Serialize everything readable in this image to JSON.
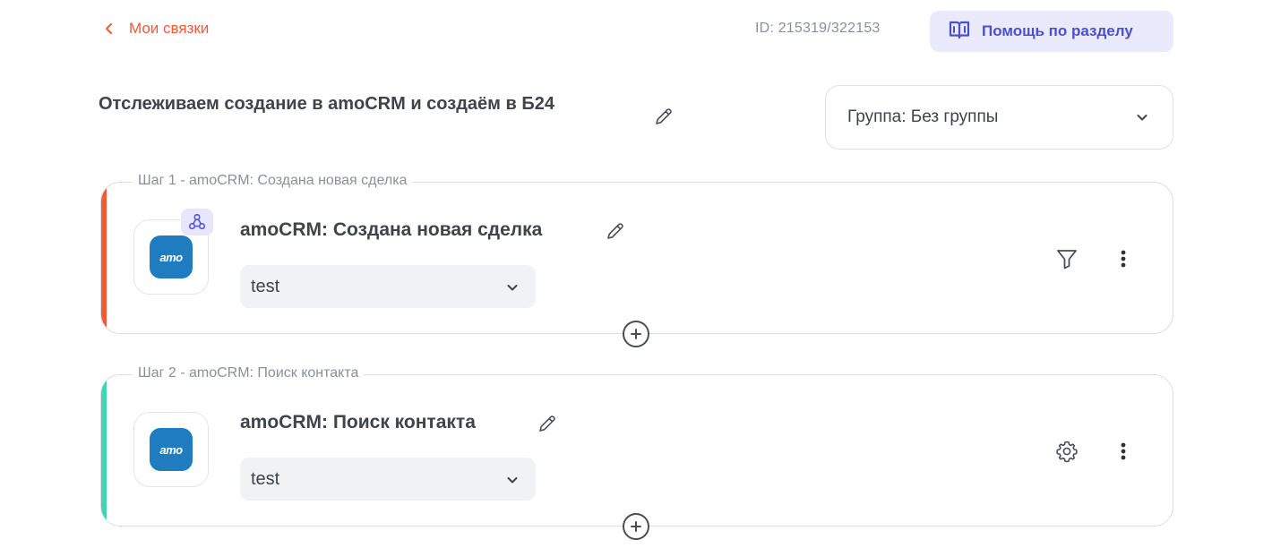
{
  "header": {
    "back_label": "Мои связки",
    "id_text": "ID: 215319/322153",
    "help_label": "Помощь по разделу"
  },
  "title": {
    "text": "Отслеживаем создание в amoCRM и создаём в Б24"
  },
  "group": {
    "label": "Группа: Без группы"
  },
  "steps": [
    {
      "legend": "Шаг 1 - amoCRM: Создана новая сделка",
      "title": "amoCRM: Создана новая сделка",
      "logo_text": "amo",
      "account": "test",
      "accent_color": "#f05a35",
      "has_webhook_badge": true,
      "side_icon": "filter-icon"
    },
    {
      "legend": "Шаг 2 - amoCRM: Поиск контакта",
      "title": "amoCRM: Поиск контакта",
      "logo_text": "amo",
      "account": "test",
      "accent_color": "#3ed4b5",
      "has_webhook_badge": false,
      "side_icon": "gear-icon"
    }
  ],
  "colors": {
    "accent": "#f05a35",
    "help_bg": "#ebeafd",
    "help_text": "#4a4fd0",
    "amo_logo": "#1f7cc1"
  }
}
